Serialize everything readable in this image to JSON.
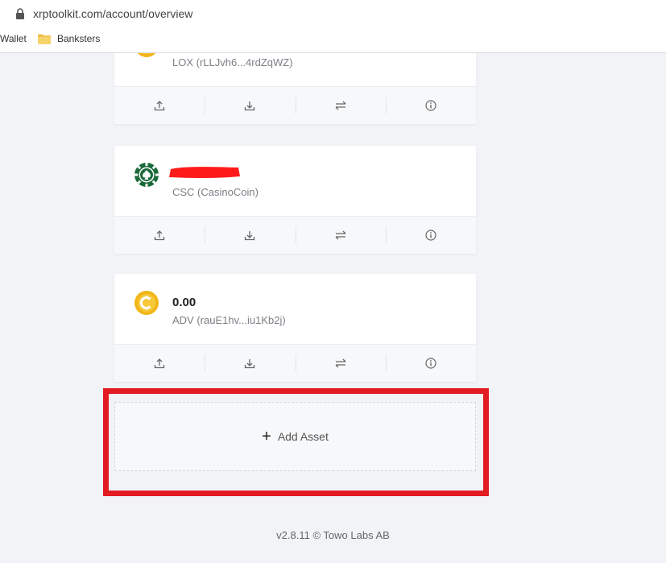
{
  "browser": {
    "url": "xrptoolkit.com/account/overview",
    "bookmarks": [
      {
        "label": "Wallet"
      },
      {
        "label": "Banksters",
        "icon": "folder-icon"
      }
    ]
  },
  "assets": [
    {
      "balance": "",
      "name": "LOX (rLLJvh6...4rdZqWZ)",
      "icon": "coin-icon",
      "color": "#f1b617"
    },
    {
      "balance": "",
      "name": "CSC (CasinoCoin)",
      "icon": "poker-chip-icon",
      "color": "#1a6b3a",
      "redacted": true
    },
    {
      "balance": "0.00",
      "name": "ADV (rauE1hv...iu1Kb2j)",
      "icon": "coin-c-icon",
      "color": "#f1b617"
    }
  ],
  "actions": [
    "send-icon",
    "receive-icon",
    "swap-icon",
    "info-icon"
  ],
  "add_asset": {
    "label": "Add Asset",
    "icon": "plus-icon"
  },
  "footer": {
    "text": "v2.8.11 © Towo Labs AB"
  },
  "colors": {
    "highlight": "#e31b23",
    "background": "#f2f3f6"
  }
}
